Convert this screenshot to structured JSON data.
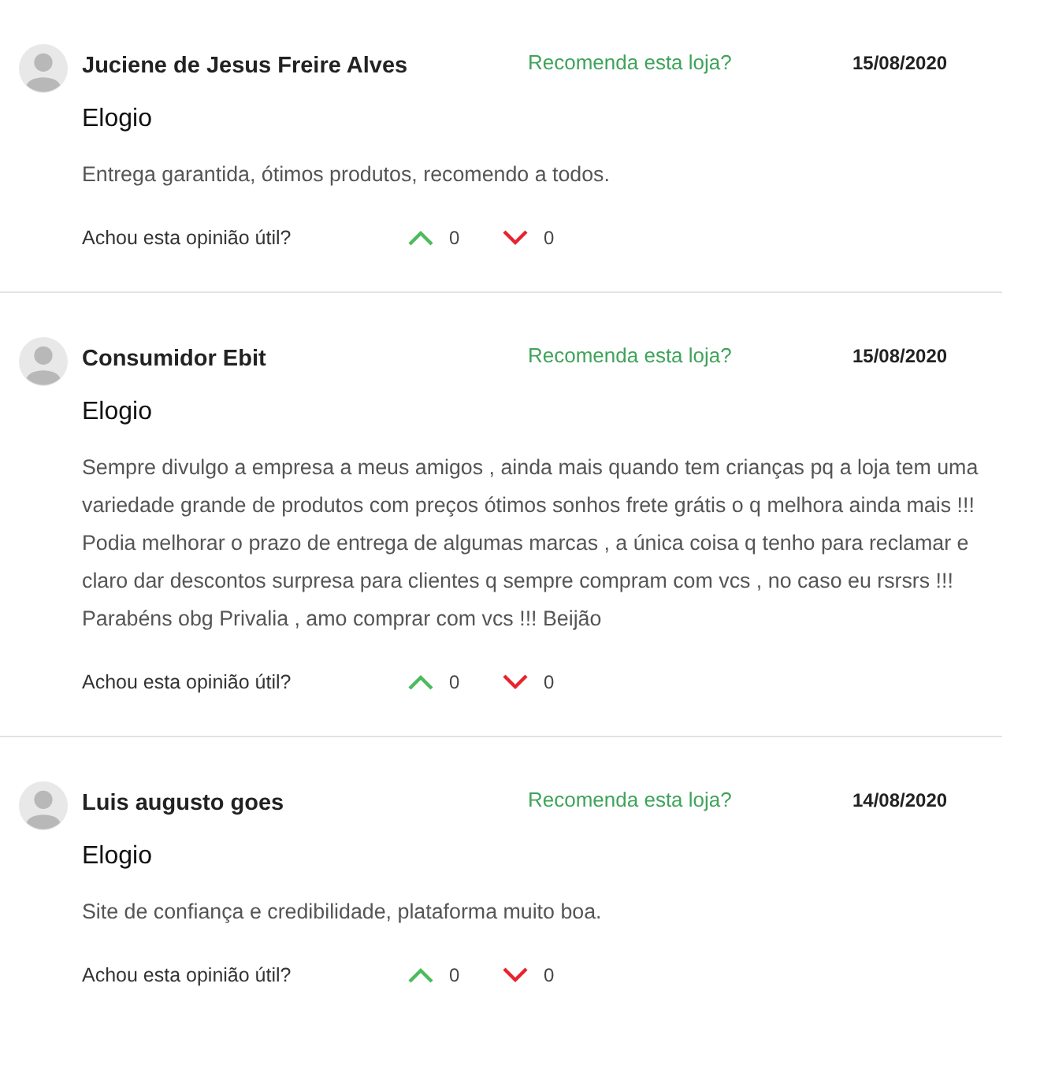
{
  "reviews": [
    {
      "author": "Juciene de Jesus Freire Alves",
      "recommend": "Recomenda esta loja?",
      "date": "15/08/2020",
      "title": "Elogio",
      "body": "Entrega garantida, ótimos produtos, recomendo a todos.",
      "helpful_label": "Achou esta opinião útil?",
      "up_count": "0",
      "down_count": "0"
    },
    {
      "author": "Consumidor Ebit",
      "recommend": "Recomenda esta loja?",
      "date": "15/08/2020",
      "title": "Elogio",
      "body": "Sempre divulgo a empresa a meus amigos , ainda mais quando tem crianças pq a loja tem uma variedade grande de produtos com preços ótimos sonhos frete grátis o q melhora ainda mais !!! Podia melhorar o prazo de entrega de algumas marcas , a única coisa q tenho para reclamar e claro dar descontos surpresa para clientes q sempre compram com vcs , no caso eu rsrsrs !!! Parabéns obg Privalia , amo comprar com vcs !!! Beijão",
      "helpful_label": "Achou esta opinião útil?",
      "up_count": "0",
      "down_count": "0"
    },
    {
      "author": "Luis augusto goes",
      "recommend": "Recomenda esta loja?",
      "date": "14/08/2020",
      "title": "Elogio",
      "body": "Site de confiança e credibilidade, plataforma muito boa.",
      "helpful_label": "Achou esta opinião útil?",
      "up_count": "0",
      "down_count": "0"
    }
  ]
}
